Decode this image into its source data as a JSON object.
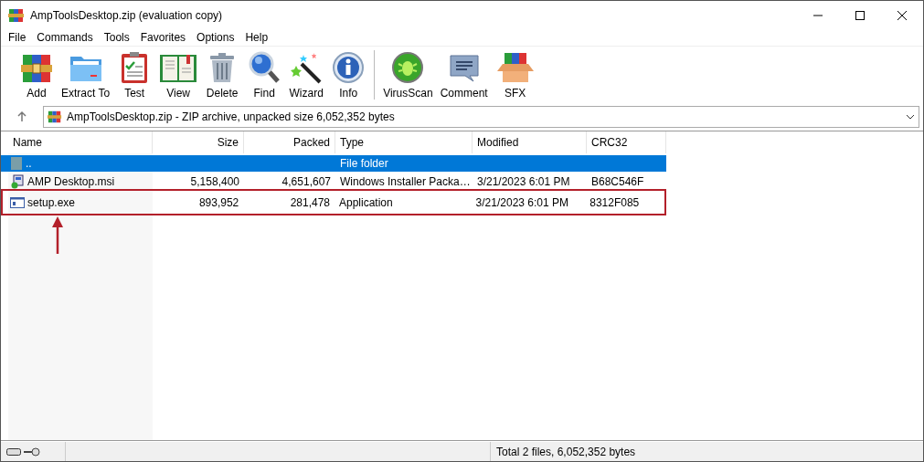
{
  "window": {
    "title": "AmpToolsDesktop.zip (evaluation copy)"
  },
  "menu": [
    "File",
    "Commands",
    "Tools",
    "Favorites",
    "Options",
    "Help"
  ],
  "toolbar": {
    "groups": [
      {
        "buttons": [
          "Add",
          "Extract To",
          "Test",
          "View",
          "Delete",
          "Find",
          "Wizard",
          "Info"
        ]
      },
      {
        "buttons": [
          "VirusScan",
          "Comment",
          "SFX"
        ]
      }
    ]
  },
  "address": {
    "text": "AmpToolsDesktop.zip - ZIP archive, unpacked size 6,052,352 bytes"
  },
  "columns": [
    {
      "label": "Name"
    },
    {
      "label": "Size"
    },
    {
      "label": "Packed"
    },
    {
      "label": "Type"
    },
    {
      "label": "Modified"
    },
    {
      "label": "CRC32"
    }
  ],
  "rows": [
    {
      "kind": "folder",
      "cells": [
        "..",
        "",
        "",
        "File folder",
        "",
        ""
      ],
      "selected": true,
      "highlighted": false
    },
    {
      "kind": "installer",
      "cells": [
        "AMP Desktop.msi",
        "5,158,400",
        "4,651,607",
        "Windows Installer Packa…",
        "3/21/2023 6:01 PM",
        "B68C546F"
      ],
      "selected": false,
      "highlighted": false
    },
    {
      "kind": "program",
      "cells": [
        "setup.exe",
        "893,952",
        "281,478",
        "Application",
        "3/21/2023 6:01 PM",
        "8312F085"
      ],
      "selected": false,
      "highlighted": true
    }
  ],
  "status_bar": {
    "text": "Total 2 files, 6,052,352 bytes"
  }
}
